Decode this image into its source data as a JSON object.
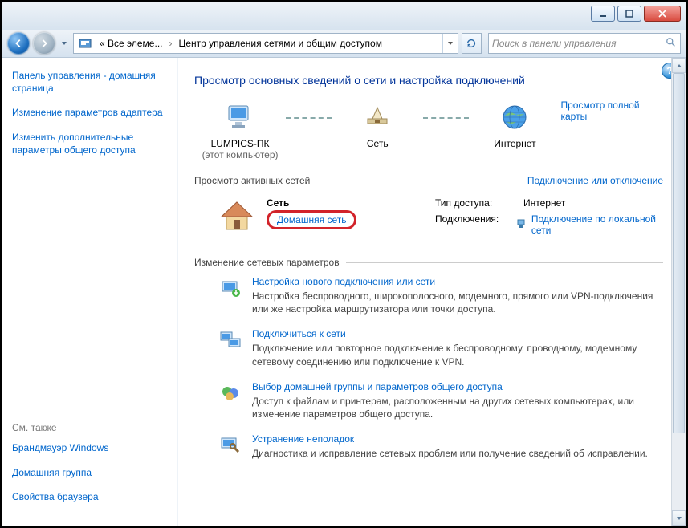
{
  "titlebar": {
    "minimize": "min",
    "maximize": "max",
    "close": "close"
  },
  "nav": {
    "crumb1": "« Все элеме...",
    "crumb2": "Центр управления сетями и общим доступом",
    "search_placeholder": "Поиск в панели управления"
  },
  "sidebar": {
    "home": "Панель управления - домашняя страница",
    "adapter": "Изменение параметров адаптера",
    "sharing": "Изменить дополнительные параметры общего доступа",
    "also_label": "См. также",
    "firewall": "Брандмауэр Windows",
    "homegroup": "Домашняя группа",
    "browser": "Свойства браузера"
  },
  "main": {
    "heading": "Просмотр основных сведений о сети и настройка подключений",
    "full_map": "Просмотр полной карты",
    "map": {
      "pc": "LUMPICS-ПК",
      "pc_sub": "(этот компьютер)",
      "net": "Сеть",
      "internet": "Интернет"
    },
    "active_label": "Просмотр активных сетей",
    "connect_toggle": "Подключение или отключение",
    "network": {
      "name": "Сеть",
      "type": "Домашняя сеть",
      "access_k": "Тип доступа:",
      "access_v": "Интернет",
      "conn_k": "Подключения:",
      "conn_v": "Подключение по локальной сети"
    },
    "change_label": "Изменение сетевых параметров",
    "opts": [
      {
        "t": "Настройка нового подключения или сети",
        "d": "Настройка беспроводного, широкополосного, модемного, прямого или VPN-подключения или же настройка маршрутизатора или точки доступа."
      },
      {
        "t": "Подключиться к сети",
        "d": "Подключение или повторное подключение к беспроводному, проводному, модемному сетевому соединению или подключение к VPN."
      },
      {
        "t": "Выбор домашней группы и параметров общего доступа",
        "d": "Доступ к файлам и принтерам, расположенным на других сетевых компьютерах, или изменение параметров общего доступа."
      },
      {
        "t": "Устранение неполадок",
        "d": "Диагностика и исправление сетевых проблем или получение сведений об исправлении."
      }
    ]
  }
}
